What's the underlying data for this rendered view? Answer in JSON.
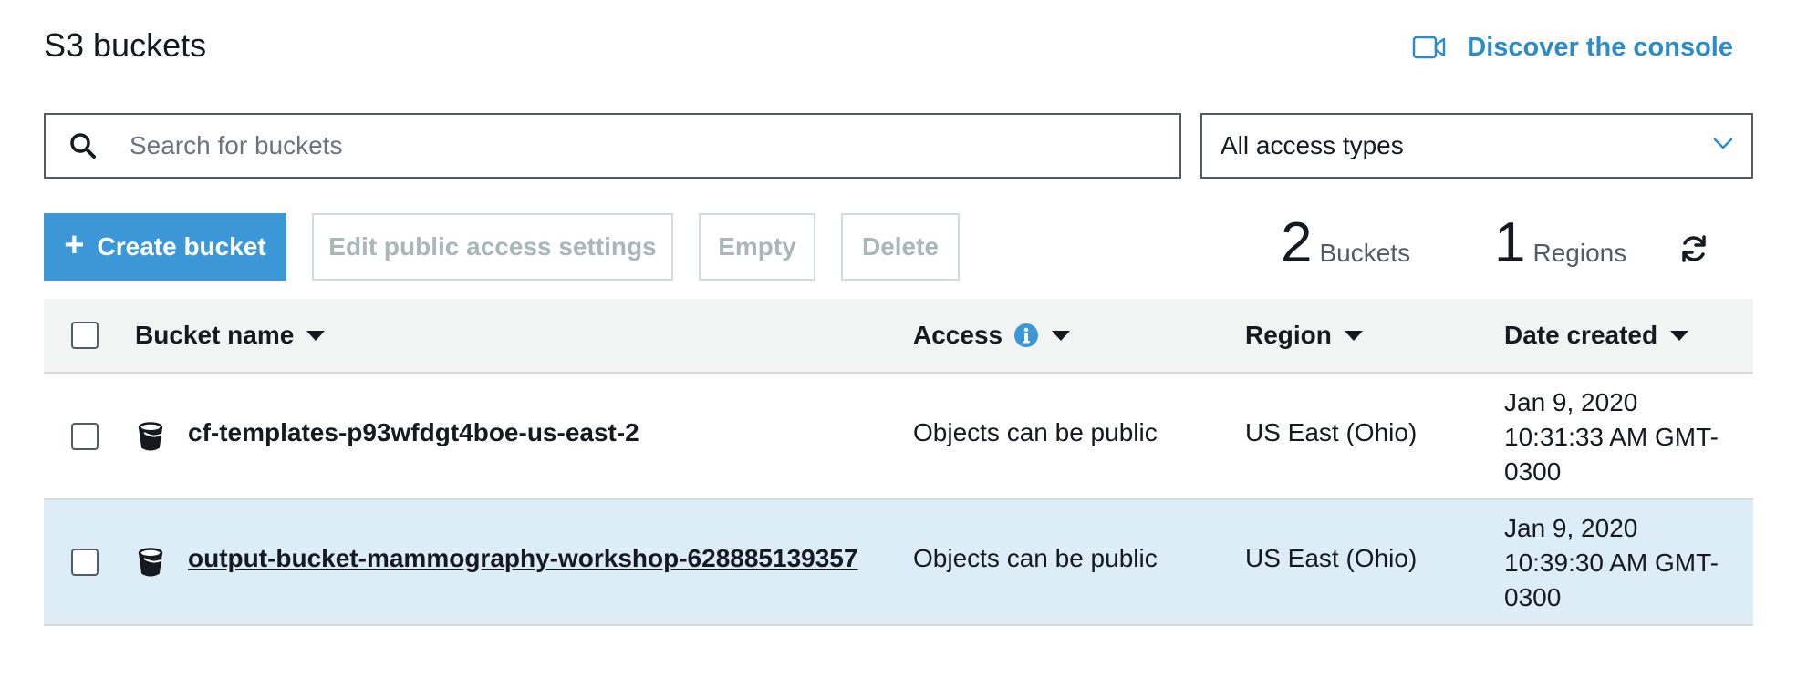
{
  "header": {
    "title": "S3 buckets",
    "discover_label": "Discover the console",
    "discover_icon": "video-camera-icon"
  },
  "search": {
    "placeholder": "Search for buckets",
    "value": ""
  },
  "access_filter": {
    "selected": "All access types"
  },
  "toolbar": {
    "create_label": "Create bucket",
    "edit_label": "Edit public access settings",
    "empty_label": "Empty",
    "delete_label": "Delete"
  },
  "stats": {
    "buckets_count": "2",
    "buckets_label": "Buckets",
    "regions_count": "1",
    "regions_label": "Regions"
  },
  "table": {
    "columns": {
      "name": "Bucket name",
      "access": "Access",
      "region": "Region",
      "date": "Date created"
    },
    "rows": [
      {
        "name": "cf-templates-p93wfdgt4boe-us-east-2",
        "access": "Objects can be public",
        "region": "US East (Ohio)",
        "date_line1": "Jan 9, 2020",
        "date_line2": "10:31:33 AM GMT-",
        "date_line3": "0300"
      },
      {
        "name": "output-bucket-mammography-workshop-628885139357",
        "access": "Objects can be public",
        "region": "US East (Ohio)",
        "date_line1": "Jan 9, 2020",
        "date_line2": "10:39:30 AM GMT-",
        "date_line3": "0300"
      }
    ]
  },
  "colors": {
    "accent": "#3b97d6",
    "link": "#2c8cc8",
    "selected_row": "#ddedf8",
    "header_bg": "#f2f3f3"
  }
}
